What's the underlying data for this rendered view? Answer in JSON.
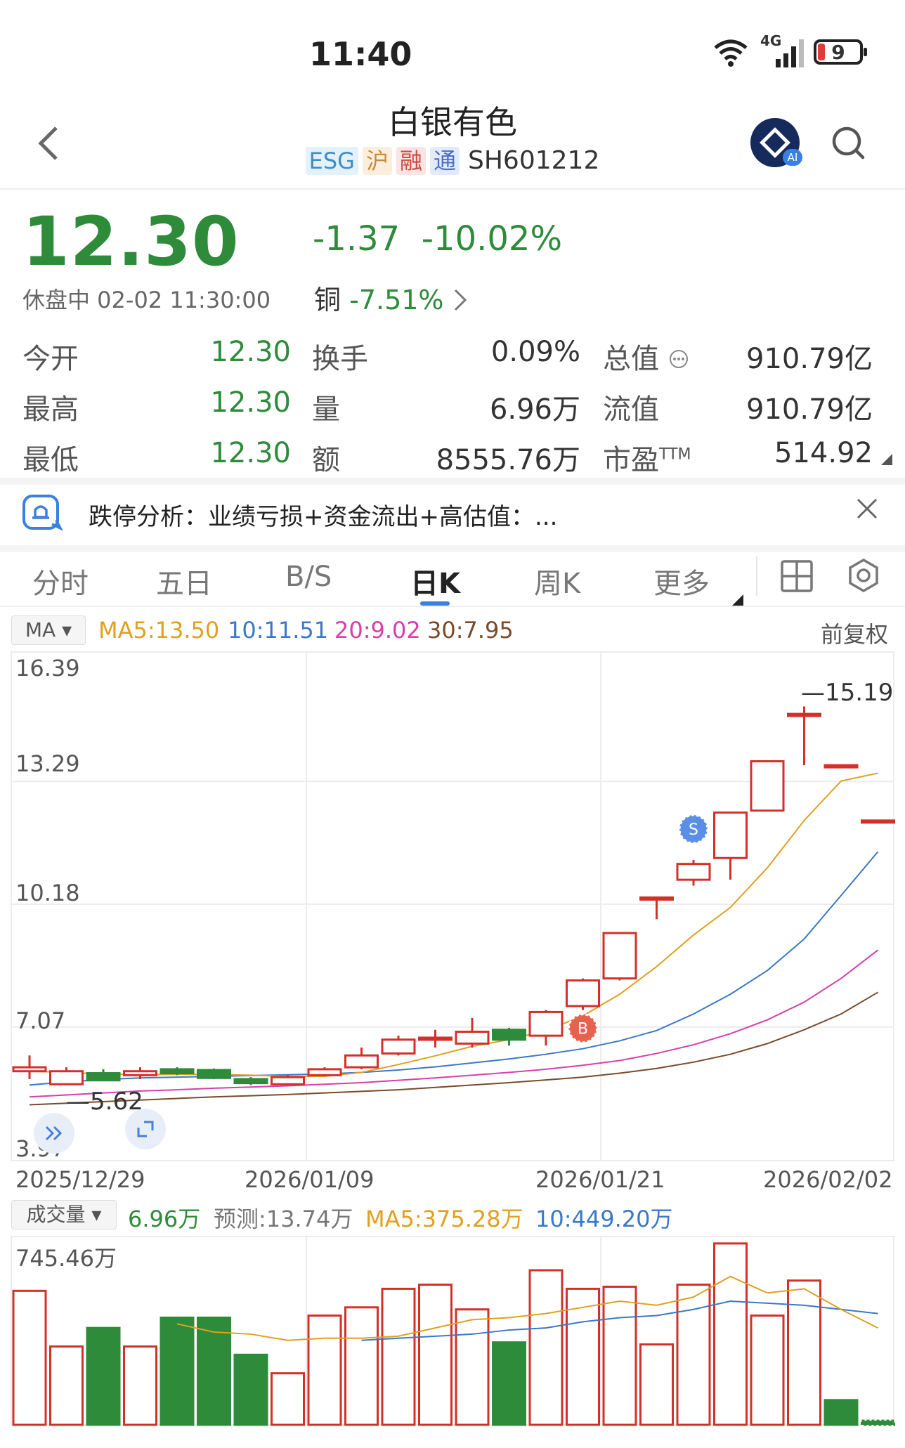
{
  "status_bar": {
    "time": "11:40",
    "network": "4G",
    "battery": "9"
  },
  "nav": {
    "title": "白银有色",
    "tags": [
      "ESG",
      "沪",
      "融",
      "通"
    ],
    "code": "SH601212",
    "ai_badge": "AI"
  },
  "quote": {
    "price": "12.30",
    "change": "-1.37",
    "change_pct": "-10.02%",
    "status": "休盘中 02-02 11:30:00",
    "sector_name": "铜",
    "sector_change": "-7.51%",
    "colors": {
      "down": "#2e8b3a",
      "up": "#d2312a"
    },
    "rows": [
      {
        "l1": "今开",
        "v1": "12.30",
        "l2": "换手",
        "v2": "0.09%",
        "l3": "总值",
        "v3": "910.79亿"
      },
      {
        "l1": "最高",
        "v1": "12.30",
        "l2": "量",
        "v2": "6.96万",
        "l3": "流值",
        "v3": "910.79亿"
      },
      {
        "l1": "最低",
        "v1": "12.30",
        "l2": "额",
        "v2": "8555.76万",
        "l3": "市盈",
        "l3_sup": "TTM",
        "v3": "514.92"
      }
    ]
  },
  "banner": {
    "text": "跌停分析：业绩亏损+资金流出+高估值：..."
  },
  "tabs": [
    "分时",
    "五日",
    "B/S",
    "日K",
    "周K",
    "更多"
  ],
  "active_tab": "日K",
  "ma_legend": {
    "selector": "MA",
    "items": [
      {
        "text": "MA5:13.50",
        "color": "#e0a020"
      },
      {
        "text": "10:11.51",
        "color": "#3a78c8"
      },
      {
        "text": "20:9.02",
        "color": "#d63fa8"
      },
      {
        "text": "30:7.95",
        "color": "#7a4a2a"
      }
    ],
    "adjust": "前复权"
  },
  "chart_data": {
    "type": "candlestick",
    "y_ticks": [
      "16.39",
      "13.29",
      "10.18",
      "7.07",
      "3.97"
    ],
    "ylim": [
      3.97,
      16.39
    ],
    "x_labels": [
      "2025/12/29",
      "2026/01/09",
      "2026/01/21",
      "2026/02/02"
    ],
    "high_label": "15.19",
    "low_label": "5.62",
    "markers": [
      {
        "label": "S",
        "index": 18
      },
      {
        "label": "B",
        "index": 15
      }
    ],
    "candles": [
      {
        "o": 5.95,
        "c": 6.05,
        "h": 6.35,
        "l": 5.75
      },
      {
        "o": 5.62,
        "c": 5.95,
        "h": 6.05,
        "l": 5.62
      },
      {
        "o": 5.9,
        "c": 5.72,
        "h": 6.0,
        "l": 5.7
      },
      {
        "o": 5.85,
        "c": 5.95,
        "h": 6.05,
        "l": 5.75
      },
      {
        "o": 6.0,
        "c": 5.9,
        "h": 6.05,
        "l": 5.85
      },
      {
        "o": 5.98,
        "c": 5.78,
        "h": 6.02,
        "l": 5.75
      },
      {
        "o": 5.75,
        "c": 5.65,
        "h": 5.8,
        "l": 5.6
      },
      {
        "o": 5.62,
        "c": 5.8,
        "h": 5.85,
        "l": 5.62
      },
      {
        "o": 5.85,
        "c": 6.0,
        "h": 6.05,
        "l": 5.82
      },
      {
        "o": 6.05,
        "c": 6.35,
        "h": 6.55,
        "l": 6.0
      },
      {
        "o": 6.4,
        "c": 6.75,
        "h": 6.85,
        "l": 6.35
      },
      {
        "o": 6.75,
        "c": 6.8,
        "h": 7.0,
        "l": 6.55
      },
      {
        "o": 6.65,
        "c": 6.95,
        "h": 7.3,
        "l": 6.55
      },
      {
        "o": 7.0,
        "c": 6.75,
        "h": 7.05,
        "l": 6.6
      },
      {
        "o": 6.85,
        "c": 7.45,
        "h": 7.5,
        "l": 6.6
      },
      {
        "o": 7.6,
        "c": 8.25,
        "h": 8.3,
        "l": 7.5
      },
      {
        "o": 8.3,
        "c": 9.45,
        "h": 9.45,
        "l": 8.25
      },
      {
        "o": 10.35,
        "c": 10.35,
        "h": 10.35,
        "l": 9.8
      },
      {
        "o": 10.8,
        "c": 11.2,
        "h": 11.3,
        "l": 10.65
      },
      {
        "o": 11.35,
        "c": 12.5,
        "h": 12.5,
        "l": 10.8
      },
      {
        "o": 12.55,
        "c": 13.8,
        "h": 13.8,
        "l": 12.55
      },
      {
        "o": 15.0,
        "c": 15.0,
        "h": 15.19,
        "l": 13.7
      },
      {
        "o": 13.7,
        "c": 13.7,
        "h": 13.7,
        "l": 13.7
      },
      {
        "o": 12.3,
        "c": 12.3,
        "h": 12.3,
        "l": 12.3
      }
    ],
    "ma": {
      "ma5": [
        5.95,
        5.92,
        5.88,
        5.86,
        5.87,
        5.87,
        5.85,
        5.82,
        5.82,
        5.92,
        6.12,
        6.34,
        6.58,
        6.75,
        6.98,
        7.35,
        7.9,
        8.6,
        9.4,
        10.1,
        11.1,
        12.3,
        13.3,
        13.5
      ],
      "ma10": [
        5.6,
        5.68,
        5.74,
        5.78,
        5.8,
        5.82,
        5.84,
        5.86,
        5.88,
        5.92,
        5.98,
        6.06,
        6.16,
        6.26,
        6.38,
        6.52,
        6.72,
        6.98,
        7.4,
        7.9,
        8.5,
        9.3,
        10.4,
        11.51
      ],
      "ma20": [
        5.3,
        5.35,
        5.4,
        5.45,
        5.48,
        5.52,
        5.55,
        5.58,
        5.62,
        5.66,
        5.72,
        5.78,
        5.85,
        5.92,
        6.0,
        6.1,
        6.22,
        6.4,
        6.62,
        6.9,
        7.25,
        7.7,
        8.3,
        9.02
      ],
      "ma30": [
        5.1,
        5.14,
        5.18,
        5.22,
        5.26,
        5.3,
        5.33,
        5.36,
        5.4,
        5.44,
        5.48,
        5.54,
        5.6,
        5.66,
        5.73,
        5.8,
        5.9,
        6.02,
        6.18,
        6.38,
        6.65,
        7.0,
        7.4,
        7.95
      ]
    }
  },
  "volume_legend": {
    "selector": "成交量",
    "current": "6.96万",
    "forecast": "预测:13.74万",
    "ma5": "MA5:375.28万",
    "ma10": "10:449.20万"
  },
  "volume_chart": {
    "type": "bar",
    "max_label": "745.46万",
    "ylim": [
      0,
      745.46
    ],
    "values": [
      650,
      380,
      470,
      380,
      520,
      520,
      340,
      250,
      530,
      570,
      660,
      680,
      560,
      400,
      750,
      660,
      670,
      390,
      680,
      880,
      530,
      700,
      120,
      20
    ],
    "up": [
      true,
      true,
      false,
      true,
      false,
      false,
      false,
      true,
      true,
      true,
      true,
      true,
      true,
      false,
      true,
      true,
      true,
      true,
      true,
      true,
      true,
      true,
      false,
      false
    ],
    "ma5": [
      null,
      null,
      null,
      null,
      490,
      450,
      440,
      410,
      420,
      420,
      430,
      470,
      510,
      520,
      540,
      570,
      600,
      580,
      620,
      720,
      640,
      660,
      560,
      470
    ],
    "ma10": [
      null,
      null,
      null,
      null,
      null,
      null,
      null,
      null,
      null,
      410,
      420,
      430,
      440,
      460,
      470,
      500,
      520,
      530,
      560,
      600,
      590,
      580,
      560,
      540
    ]
  }
}
